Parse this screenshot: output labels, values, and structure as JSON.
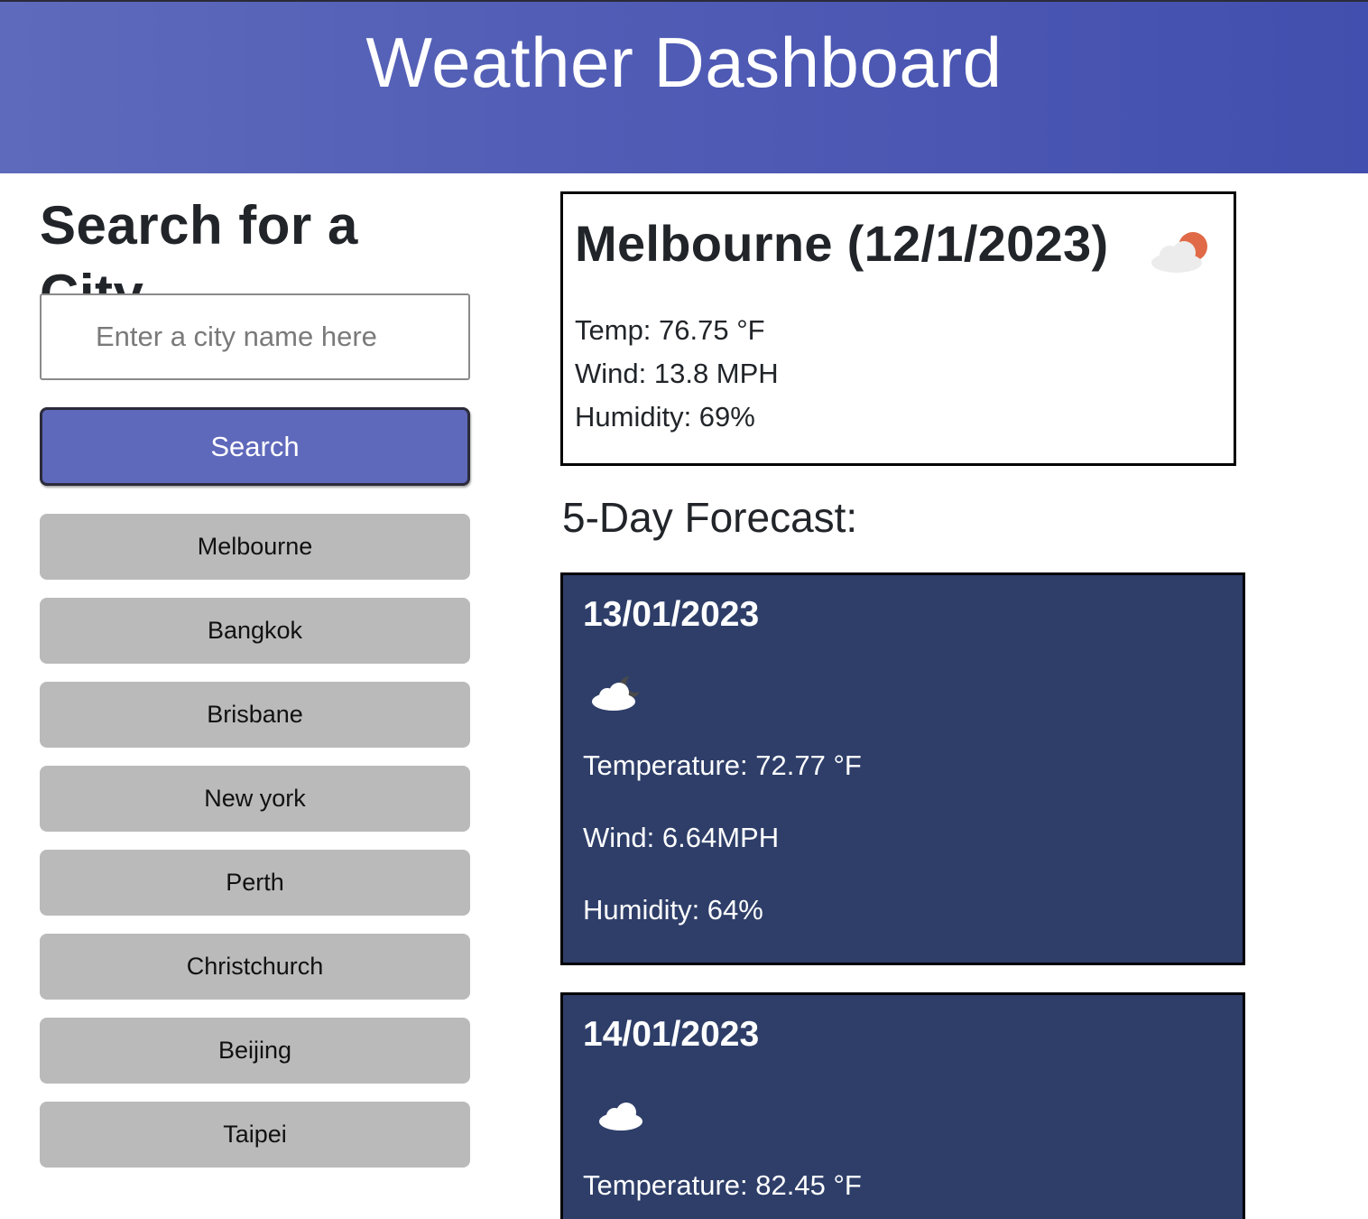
{
  "header": {
    "title": "Weather Dashboard"
  },
  "sidebar": {
    "heading": "Search for a City",
    "search_placeholder": "Enter a city name here",
    "search_button": "Search",
    "cities": [
      "Melbourne",
      "Bangkok",
      "Brisbane",
      "New york",
      "Perth",
      "Christchurch",
      "Beijing",
      "Taipei"
    ]
  },
  "current": {
    "title": "Melbourne (12/1/2023)",
    "icon": "partly-cloudy-sun-icon",
    "temp": "Temp: 76.75 °F",
    "wind": "Wind: 13.8 MPH",
    "humidity": "Humidity: 69%"
  },
  "forecast": {
    "title": "5-Day Forecast:",
    "days": [
      {
        "date": "13/01/2023",
        "icon": "cloudy-night-icon",
        "temperature": "Temperature: 72.77 °F",
        "wind": "Wind: 6.64MPH",
        "humidity": "Humidity: 64%"
      },
      {
        "date": "14/01/2023",
        "icon": "cloud-icon",
        "temperature": "Temperature: 82.45 °F"
      }
    ]
  },
  "colors": {
    "header_bg": "#5a66b9",
    "search_button_bg": "#5f69bb",
    "city_button_bg": "#bababa",
    "forecast_card_bg": "#2e3e69",
    "sun": "#e06a47"
  }
}
